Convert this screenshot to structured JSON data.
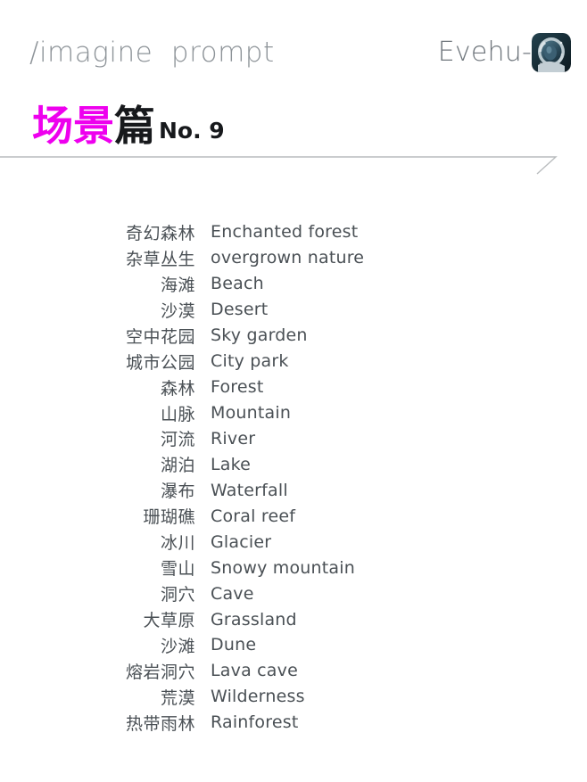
{
  "header": {
    "command_text": "/imagine  prompt",
    "brand_name": "Evehu-",
    "avatar_icon": "astronaut-avatar-icon",
    "avatar_colors": {
      "background": "#1d343d",
      "helmet": "#cfd8dc",
      "visor": "#2e4a5a",
      "highlight": "#9fb6c2"
    }
  },
  "title": {
    "cn_pink": "场景",
    "cn_dark": "篇",
    "number": "No. 9",
    "pink_color": "#ee00ee",
    "dark_color": "#17191c"
  },
  "divider": {
    "line_color": "#b9bcbe",
    "name": "header-divider"
  },
  "list": {
    "items": [
      {
        "cn": "奇幻森林",
        "en": "Enchanted forest"
      },
      {
        "cn": "杂草丛生",
        "en": "overgrown nature"
      },
      {
        "cn": "海滩",
        "en": "Beach"
      },
      {
        "cn": "沙漠",
        "en": "Desert"
      },
      {
        "cn": "空中花园",
        "en": "Sky garden"
      },
      {
        "cn": "城市公园",
        "en": "City park"
      },
      {
        "cn": "森林",
        "en": "Forest"
      },
      {
        "cn": "山脉",
        "en": "Mountain"
      },
      {
        "cn": "河流",
        "en": "River"
      },
      {
        "cn": "湖泊",
        "en": "Lake"
      },
      {
        "cn": "瀑布",
        "en": "Waterfall"
      },
      {
        "cn": "珊瑚礁",
        "en": "Coral reef"
      },
      {
        "cn": "冰川",
        "en": "Glacier"
      },
      {
        "cn": "雪山",
        "en": "Snowy mountain"
      },
      {
        "cn": "洞穴",
        "en": "Cave"
      },
      {
        "cn": "大草原",
        "en": "Grassland"
      },
      {
        "cn": "沙滩",
        "en": "Dune"
      },
      {
        "cn": "熔岩洞穴",
        "en": "Lava cave"
      },
      {
        "cn": "荒漠",
        "en": "Wilderness"
      },
      {
        "cn": "热带雨林",
        "en": "Rainforest"
      }
    ]
  }
}
